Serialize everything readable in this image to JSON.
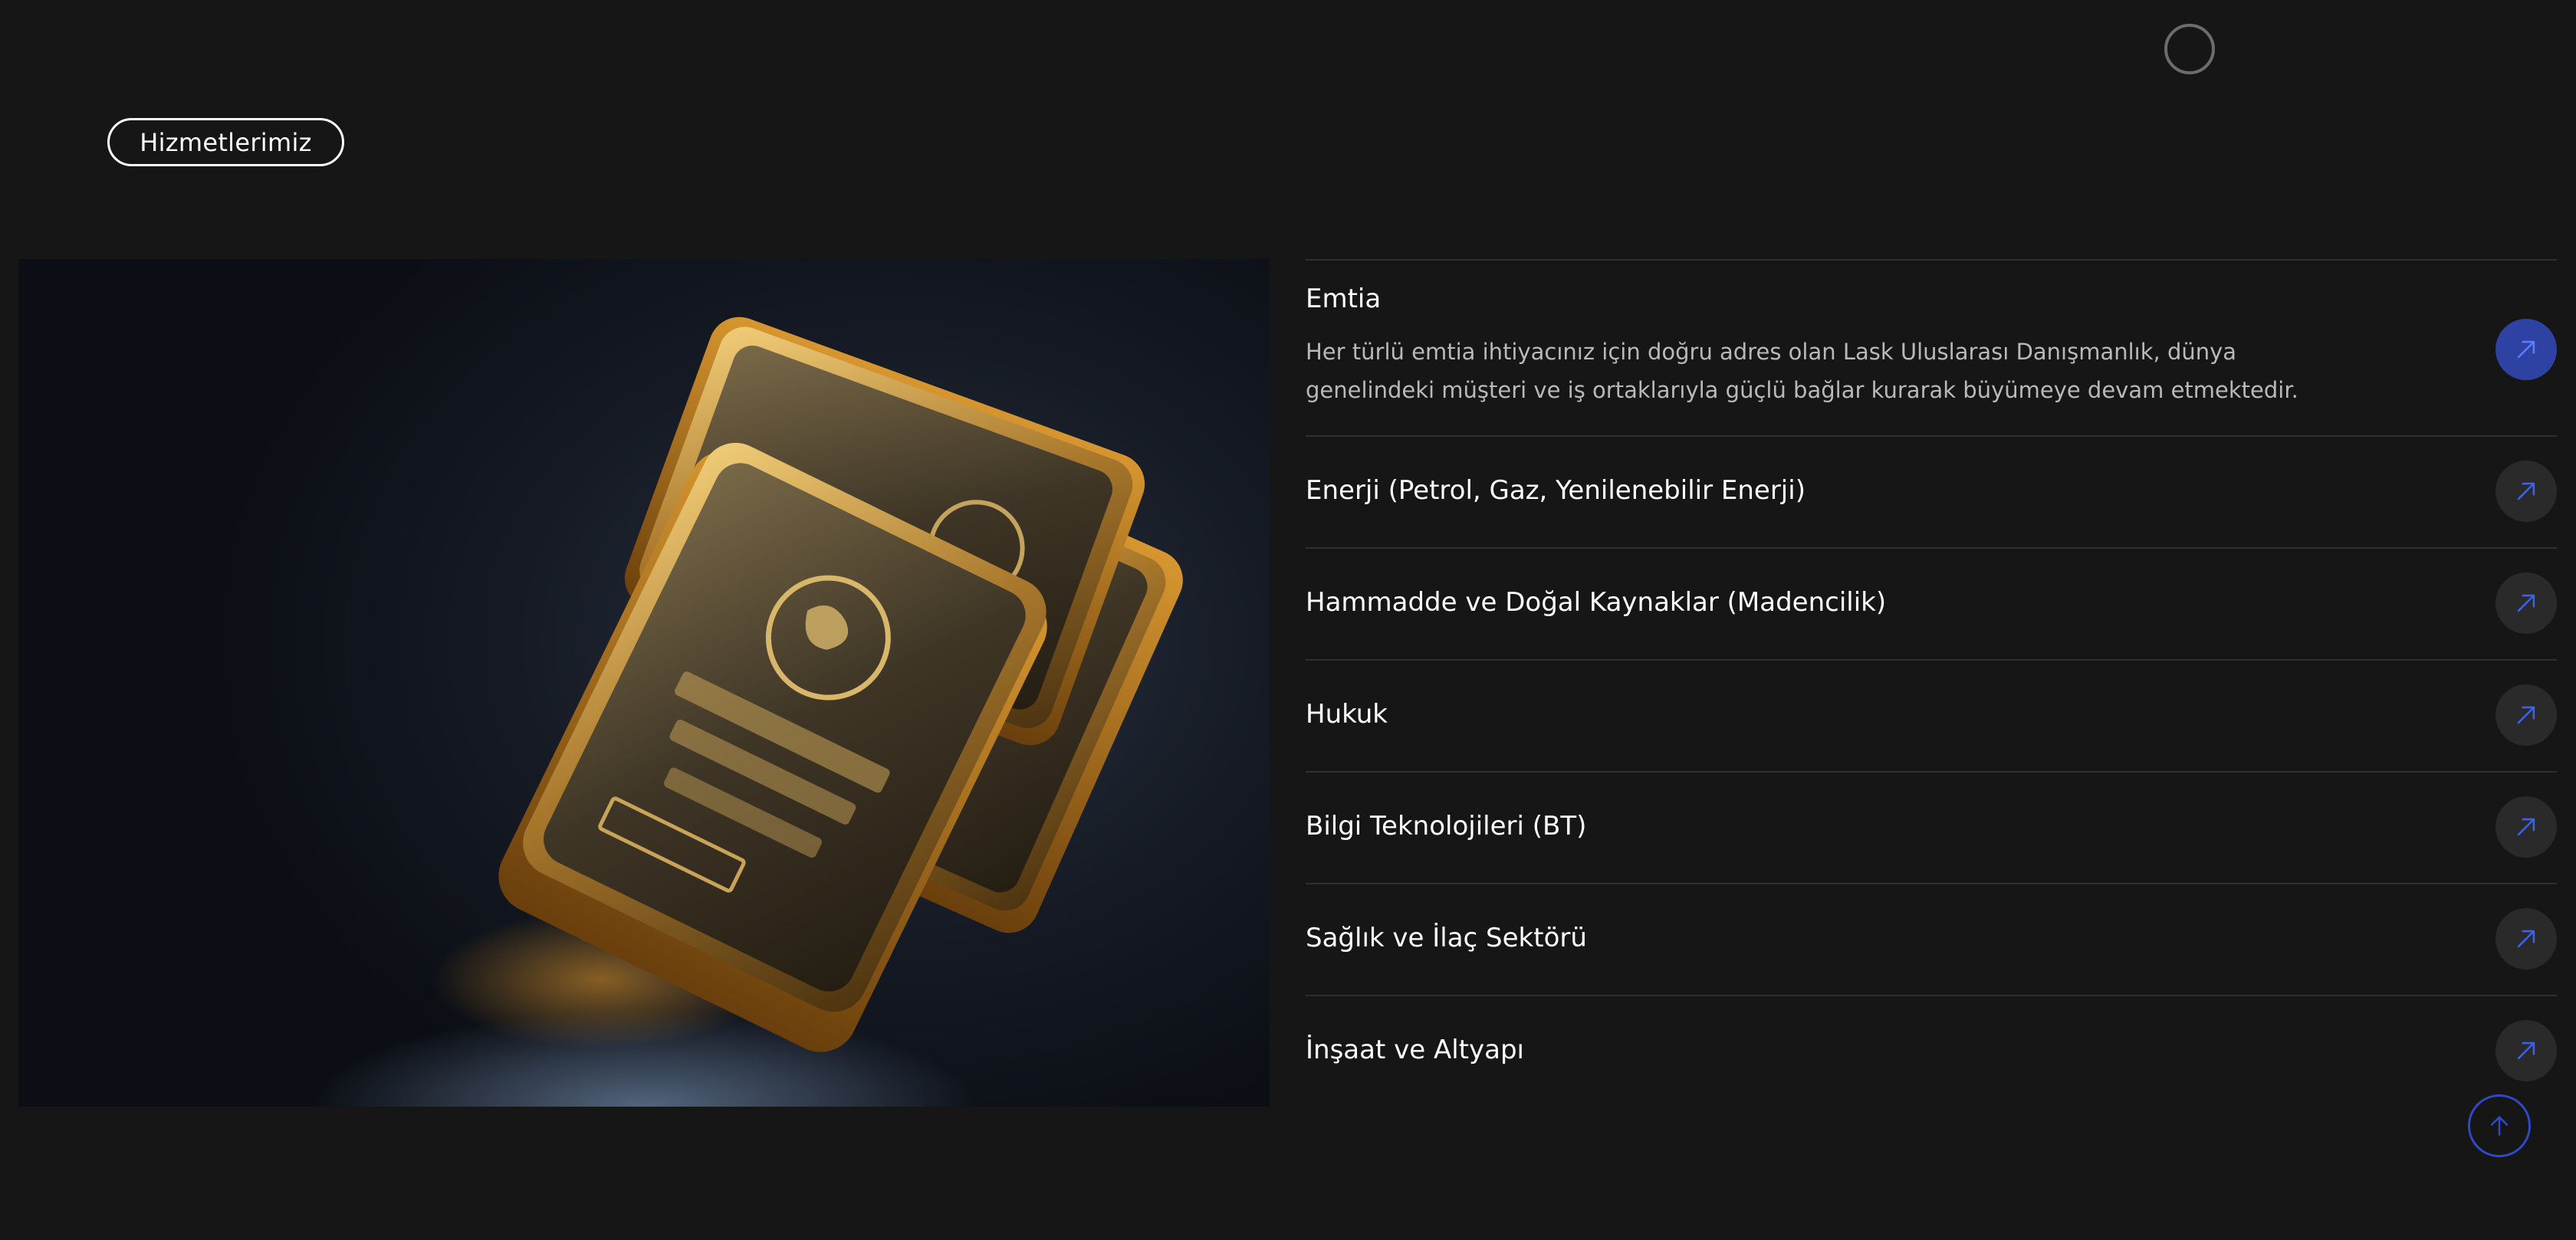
{
  "section": {
    "badge": "Hizmetlerimiz"
  },
  "hero_image": {
    "alt": "Gold bars"
  },
  "services": {
    "items": [
      {
        "title": "Emtia",
        "description": "Her türlü emtia ihtiyacınız için doğru adres olan Lask Uluslarası Danışmanlık, dünya genelindeki müşteri ve iş ortaklarıyla güçlü bağlar kurarak büyümeye devam etmektedir.",
        "expanded": true
      },
      {
        "title": "Enerji (Petrol, Gaz, Yenilenebilir Enerji)",
        "expanded": false
      },
      {
        "title": "Hammadde ve Doğal Kaynaklar (Madencilik)",
        "expanded": false
      },
      {
        "title": "Hukuk",
        "expanded": false
      },
      {
        "title": "Bilgi Teknolojileri (BT)",
        "expanded": false
      },
      {
        "title": "Sağlık ve İlaç Sektörü",
        "expanded": false
      },
      {
        "title": "İnşaat ve Altyapı",
        "expanded": false
      }
    ]
  },
  "icons": {
    "item_arrow": "arrow-up-right-icon",
    "scroll_top": "arrow-up-icon",
    "cursor": "cursor-ring-icon"
  },
  "colors": {
    "background": "#161616",
    "accent": "#2f49c8",
    "active_button": "#2d42a3",
    "inactive_button": "#2a2a2a",
    "divider": "#2f2f2f",
    "muted_text": "#b9b9b9"
  }
}
